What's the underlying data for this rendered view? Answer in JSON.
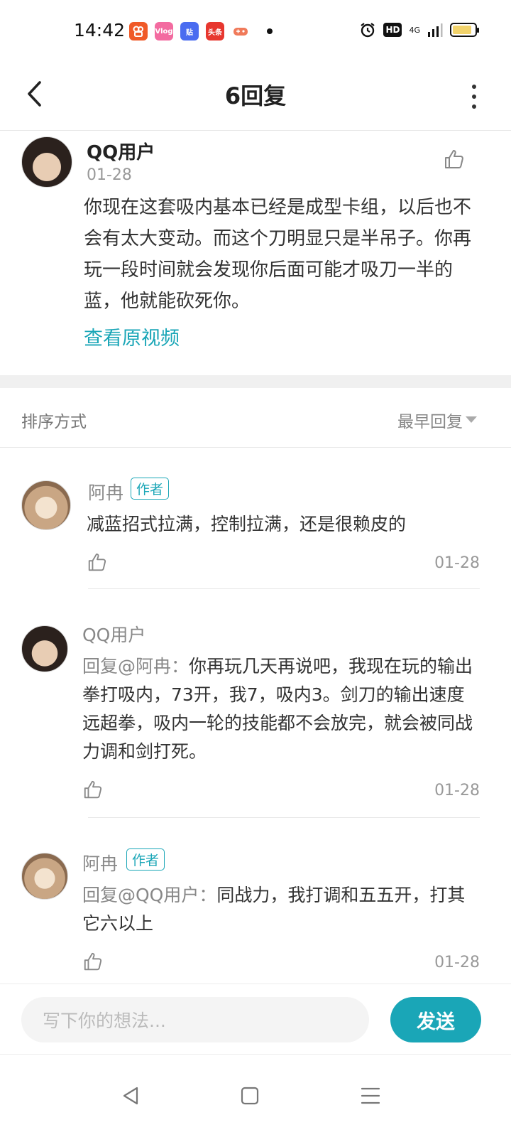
{
  "status_bar": {
    "time": "14:42",
    "apps": [
      {
        "icon": "kuaishou-app-icon",
        "label": "",
        "color": "#f05a28"
      },
      {
        "icon": "video-app-icon",
        "label": "Vlog",
        "color": "#f36ba0"
      },
      {
        "icon": "tieba-app-icon",
        "label": "贴",
        "color": "#4a6cf0"
      },
      {
        "icon": "toutiao-app-icon",
        "label": "头条",
        "color": "#e7372f"
      },
      {
        "icon": "game-app-icon",
        "label": "",
        "color": "#f07a5a"
      }
    ],
    "hd_label": "HD",
    "network_label": "4G"
  },
  "nav": {
    "title": "6回复"
  },
  "main_comment": {
    "user": "QQ用户",
    "date": "01-28",
    "text": "你现在这套吸内基本已经是成型卡组，以后也不会有太大变动。而这个刀明显只是半吊子。你再玩一段时间就会发现你后面可能才吸刀一半的蓝，他就能砍死你。",
    "view_video": "查看原视频"
  },
  "sort": {
    "label": "排序方式",
    "value": "最早回复"
  },
  "replies": [
    {
      "user": "阿冉",
      "badge": "作者",
      "mention": "",
      "text": "减蓝招式拉满，控制拉满，还是很赖皮的",
      "date": "01-28"
    },
    {
      "user": "QQ用户",
      "badge": "",
      "mention": "回复@阿冉：",
      "text": "你再玩几天再说吧，我现在玩的输出拳打吸内，73开，我7，吸内3。剑刀的输出速度远超拳，吸内一轮的技能都不会放完，就会被同战力调和剑打死。",
      "date": "01-28"
    },
    {
      "user": "阿冉",
      "badge": "作者",
      "mention": "回复@QQ用户：",
      "text": "同战力，我打调和五五开，打其它六以上",
      "date": "01-28"
    }
  ],
  "input": {
    "placeholder": "写下你的想法...",
    "send_label": "发送"
  },
  "colors": {
    "accent": "#1aa6b7"
  }
}
